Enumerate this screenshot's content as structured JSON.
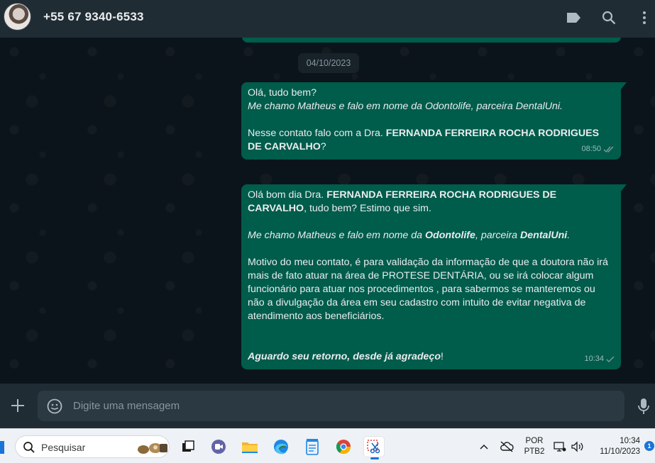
{
  "header": {
    "contact_name": "+55 67 9340-6533",
    "icons": [
      "label-icon",
      "search-icon",
      "menu-dots-icon"
    ]
  },
  "chat": {
    "date_chip": "04/10/2023",
    "messages": [
      {
        "time": "08:50",
        "status": "read-double-check",
        "line1": "Olá, tudo bem?",
        "line2": "Me chamo Matheus e falo em nome da Odontolife, parceira DentalUni.",
        "line3_pre": "Nesse contato falo com a Dra. ",
        "line3_bold": "FERNANDA FERREIRA ROCHA RODRIGUES DE CARVALHO",
        "line3_post": "?"
      },
      {
        "time": "10:34",
        "status": "sent-single-check",
        "p1_pre": "Olá bom dia Dra. ",
        "p1_bold": "FERNANDA FERREIRA ROCHA RODRIGUES DE CARVALHO",
        "p1_post": ", tudo bem? Estimo que sim.",
        "p2_a": "Me chamo Matheus e falo em nome da ",
        "p2_b": "Odontolife",
        "p2_c": ", parceira ",
        "p2_d": "DentalUni",
        "p2_e": ".",
        "p3": "Motivo do meu contato, é para validação da informação de que a doutora não irá mais de fato atuar na área de PROTESE DENTÁRIA, ou se irá colocar algum funcionário para atuar nos procedimentos , para sabermos se manteremos ou não a divulgação da área em seu cadastro com intuito de evitar negativa de atendimento aos beneficiários.",
        "p4_bold": "Aguardo seu retorno, desde já agradeço",
        "p4_post": "!"
      }
    ]
  },
  "composer": {
    "placeholder": "Digite uma mensagem"
  },
  "taskbar": {
    "search_placeholder": "Pesquisar",
    "apps": [
      "task-view-icon",
      "teams-icon",
      "file-explorer-icon",
      "edge-icon",
      "notepad-icon",
      "chrome-icon",
      "snipping-tool-icon"
    ],
    "lang_top": "POR",
    "lang_bottom": "PTB2",
    "time": "10:34",
    "date": "11/10/2023",
    "notification_count": "1"
  },
  "colors": {
    "outgoing_bubble": "#005c4b",
    "header_bg": "#202c33",
    "chat_bg": "#0b141a",
    "read_tick": "#8696a0"
  }
}
